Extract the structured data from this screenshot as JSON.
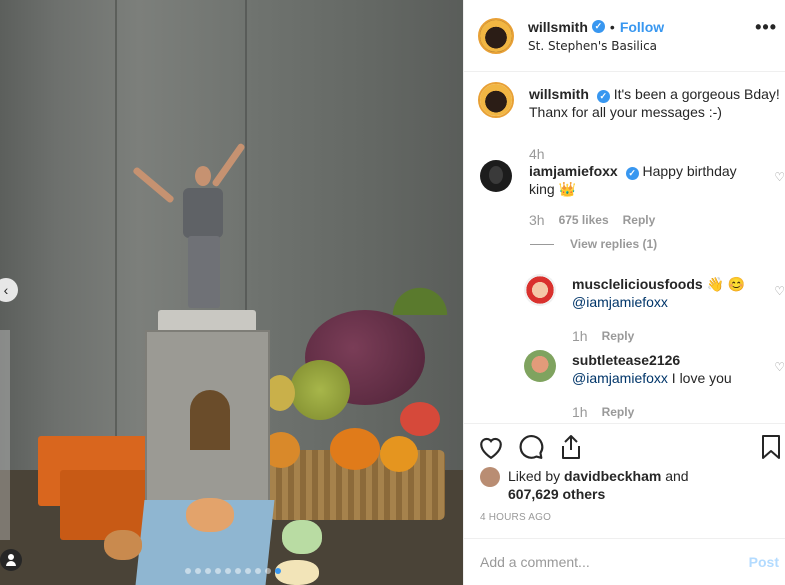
{
  "post": {
    "username": "willsmith",
    "follow_label": "Follow",
    "dot": "•",
    "location": "St. Stephen's Basilica",
    "more_icon": "more-horizontal-icon",
    "caption": "It's been a gorgeous Bday! Thanx for all your messages :-)",
    "caption_time": "4h"
  },
  "comments": [
    {
      "username": "iamjamiefoxx",
      "verified": true,
      "text": "Happy birthday king 👑",
      "time": "3h",
      "likes": "675 likes",
      "reply_label": "Reply",
      "view_replies": "View replies (1)"
    },
    {
      "username": "muscleliciousfoods",
      "text_emoji": "👋 😊",
      "mention": "@iamjamiefoxx",
      "time": "1h",
      "reply_label": "Reply"
    },
    {
      "username": "subtletease2126",
      "mention": "@iamjamiefoxx",
      "text": "I love you",
      "time": "1h",
      "reply_label": "Reply"
    }
  ],
  "actions": {
    "like_icon": "heart-icon",
    "comment_icon": "comment-icon",
    "share_icon": "share-icon",
    "save_icon": "bookmark-icon"
  },
  "likes": {
    "prefix": "Liked by",
    "user": "davidbeckham",
    "and": "and",
    "count": "607,629 others"
  },
  "date": "4 HOURS AGO",
  "add_comment": {
    "placeholder": "Add a comment...",
    "post_label": "Post"
  },
  "carousel": {
    "prev_icon": "chevron-left-icon",
    "tag_icon": "user-tag-icon"
  },
  "colors": {
    "accent": "#3897f0",
    "muted": "#999999",
    "text": "#262626",
    "post_disabled": "#b3dbff"
  }
}
